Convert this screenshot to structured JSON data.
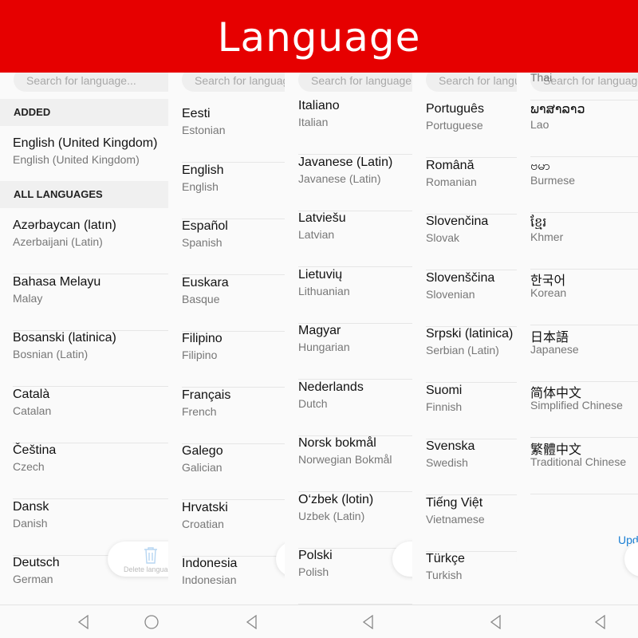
{
  "title": "Language",
  "search_placeholder": "Search for language...",
  "sections": {
    "added": "ADDED",
    "all": "ALL LANGUAGES"
  },
  "delete_label": "Delete language",
  "update_link": "Upd",
  "panels": [
    {
      "added": [
        {
          "t": "English (United Kingdom)",
          "s": "English (United Kingdom)"
        }
      ],
      "items": [
        {
          "t": "Azərbaycan (latın)",
          "s": "Azerbaijani (Latin)"
        },
        {
          "t": "Bahasa Melayu",
          "s": "Malay"
        },
        {
          "t": "Bosanski (latinica)",
          "s": "Bosnian (Latin)"
        },
        {
          "t": "Català",
          "s": "Catalan"
        },
        {
          "t": "Čeština",
          "s": "Czech"
        },
        {
          "t": "Dansk",
          "s": "Danish"
        },
        {
          "t": "Deutsch",
          "s": "German"
        }
      ]
    },
    {
      "items": [
        {
          "t": "Eesti",
          "s": "Estonian"
        },
        {
          "t": "English",
          "s": "English"
        },
        {
          "t": "Español",
          "s": "Spanish"
        },
        {
          "t": "Euskara",
          "s": "Basque"
        },
        {
          "t": "Filipino",
          "s": "Filipino"
        },
        {
          "t": "Français",
          "s": "French"
        },
        {
          "t": "Galego",
          "s": "Galician"
        },
        {
          "t": "Hrvatski",
          "s": "Croatian"
        },
        {
          "t": "Indonesia",
          "s": "Indonesian"
        }
      ]
    },
    {
      "items": [
        {
          "t": "Italiano",
          "s": "Italian"
        },
        {
          "t": "Javanese (Latin)",
          "s": "Javanese (Latin)"
        },
        {
          "t": "Latviešu",
          "s": "Latvian"
        },
        {
          "t": "Lietuvių",
          "s": "Lithuanian"
        },
        {
          "t": "Magyar",
          "s": "Hungarian"
        },
        {
          "t": "Nederlands",
          "s": "Dutch"
        },
        {
          "t": "Norsk bokmål",
          "s": "Norwegian Bokmål"
        },
        {
          "t": "O‘zbek (lotin)",
          "s": "Uzbek (Latin)"
        },
        {
          "t": "Polski",
          "s": "Polish"
        }
      ]
    },
    {
      "items": [
        {
          "t": "Português",
          "s": "Portuguese"
        },
        {
          "t": "Română",
          "s": "Romanian"
        },
        {
          "t": "Slovenčina",
          "s": "Slovak"
        },
        {
          "t": "Slovenščina",
          "s": "Slovenian"
        },
        {
          "t": "Srpski (latinica)",
          "s": "Serbian (Latin)"
        },
        {
          "t": "Suomi",
          "s": "Finnish"
        },
        {
          "t": "Svenska",
          "s": "Swedish"
        },
        {
          "t": "Tiếng Việt",
          "s": "Vietnamese"
        },
        {
          "t": "Türkçe",
          "s": "Turkish"
        }
      ]
    },
    {
      "items": [
        {
          "t": "",
          "s": "Thai"
        },
        {
          "t": "ພາສາລາວ",
          "s": "Lao"
        },
        {
          "t": "ဗမာ",
          "s": "Burmese"
        },
        {
          "t": "ខ្មែរ",
          "s": "Khmer"
        },
        {
          "t": "한국어",
          "s": "Korean"
        },
        {
          "t": "日本語",
          "s": "Japanese"
        },
        {
          "t": "简体中文",
          "s": "Simplified Chinese"
        },
        {
          "t": "繁體中文",
          "s": "Traditional Chinese"
        }
      ]
    }
  ],
  "nav": {
    "back": "back-icon",
    "home": "home-icon"
  }
}
